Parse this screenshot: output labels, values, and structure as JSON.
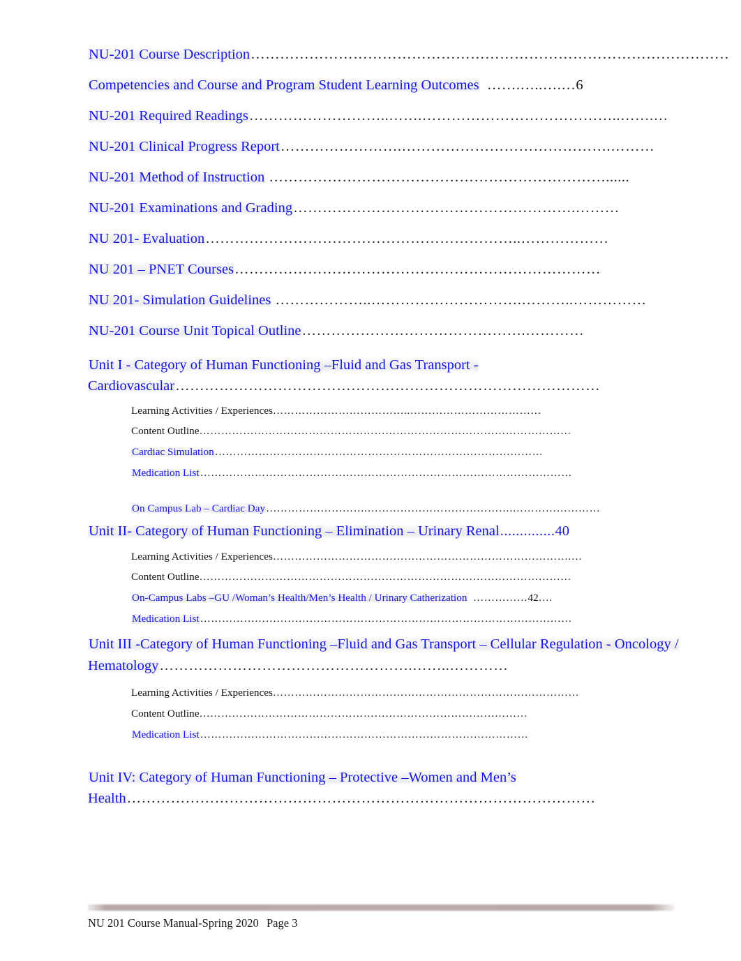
{
  "document": {
    "type": "table-of-contents",
    "page_label": "Page 3",
    "colors": {
      "link_blue": "#1515e0",
      "body_black": "#111111",
      "footer_rule": "#b9a8a8"
    }
  },
  "toc": {
    "entries": [
      {
        "level": 1,
        "label": "NU-201 Course Description",
        "leader": "…………………………………………………………………………………………",
        "page": "",
        "color": "blue"
      },
      {
        "level": 1,
        "label": "Competencies and Course and Program Student Learning Outcomes",
        "leader": "…….…..….…",
        "page": "6",
        "color": "blue",
        "page_color": "black"
      },
      {
        "level": 1,
        "label": "NU-201 Required Readings",
        "leader": "………………………..…….…………………………………..…….…",
        "page": "",
        "color": "blue"
      },
      {
        "level": 1,
        "label": "NU-201 Clinical Progress Report",
        "leader": "…………………….…………………………………….………",
        "page": "",
        "color": "blue"
      },
      {
        "level": 1,
        "label": "NU-201 Method of Instruction",
        "leader": "……………………………………………………………......",
        "page": "",
        "color": "blue"
      },
      {
        "level": 1,
        "label": "NU-201 Examinations and Grading",
        "leader": "………………………………………………….………",
        "page": "",
        "color": "blue"
      },
      {
        "level": 1,
        "label": "NU 201- Evaluation",
        "leader": "………………………………………………………..………………",
        "page": "",
        "color": "blue"
      },
      {
        "level": 1,
        "label": "NU 201 – PNET Courses",
        "leader": "…………………………………………………………………",
        "page": "",
        "color": "blue"
      },
      {
        "level": 1,
        "label": "NU 201- Simulation Guidelines",
        "leader": "………………..………………………….………..……………",
        "page": "",
        "color": "blue"
      },
      {
        "level": 1,
        "label": "NU-201 Course Unit Topical Outline",
        "leader": "……………………………………….…………",
        "page": "",
        "color": "blue"
      }
    ],
    "unit_1": {
      "heading_text": "Unit I - Category of Human Functioning –Fluid and Gas Transport - Cardiovascular",
      "heading_leader": "……………………………………………………………………………",
      "sub": [
        {
          "label": "Learning Activities / Experiences",
          "leader": "………………………………..………………………………",
          "color": "black"
        },
        {
          "label": "Content Outline",
          "leader": "…………………………………………………………………………………………",
          "color": "black"
        },
        {
          "label": "Cardiac Simulation",
          "leader": "………………………………………………………………………………",
          "color": "blue"
        },
        {
          "label": "Medication List",
          "leader": "…………………………………………………………………………………………",
          "color": "blue"
        },
        {
          "label": "On Campus Lab – Cardiac Day",
          "leader": "……………………….………………………………….……………………",
          "color": "blue"
        }
      ]
    },
    "unit_2": {
      "heading_text": "Unit II- Category of Human Functioning – Elimination – Urinary Renal",
      "heading_leader": "..............",
      "heading_page": "40",
      "sub": [
        {
          "label": "Learning Activities / Experiences",
          "leader": "……………………………………………………………………….…",
          "color": "black"
        },
        {
          "label": "Content Outline",
          "leader": "…………………………………………………………………………………………",
          "color": "black"
        },
        {
          "label": "On-Campus Labs –GU /Woman’s Health/Men’s Health / Urinary Catherization",
          "leader": "……………",
          "page": "42",
          "trailer": "….",
          "color": "blue",
          "page_color": "black"
        },
        {
          "label": "Medication List",
          "leader": "…………………………………………………………………………………………",
          "color": "blue"
        }
      ]
    },
    "unit_3": {
      "heading_text": "Unit III -Category of Human Functioning –Fluid and Gas Transport – Cellular Regulation   - Oncology / Hematology",
      "heading_leader": "…………………………………………….……..…………",
      "sub": [
        {
          "label": "Learning Activities / Experiences",
          "leader": "…………………………………………………………………………",
          "color": "black"
        },
        {
          "label": "Content Outline",
          "leader": "………………………………………………………………………………",
          "color": "black"
        },
        {
          "label": "Medication List",
          "leader": "………………………………………………………………………………",
          "color": "blue"
        }
      ]
    },
    "unit_4": {
      "heading_text": "Unit IV: Category of Human Functioning – Protective  –Women and Men’s Health",
      "heading_leader": "……………………………………………………………………………………"
    }
  },
  "footer": {
    "left": "NU 201 Course Manual-Spring 2020",
    "page": "Page 3"
  }
}
